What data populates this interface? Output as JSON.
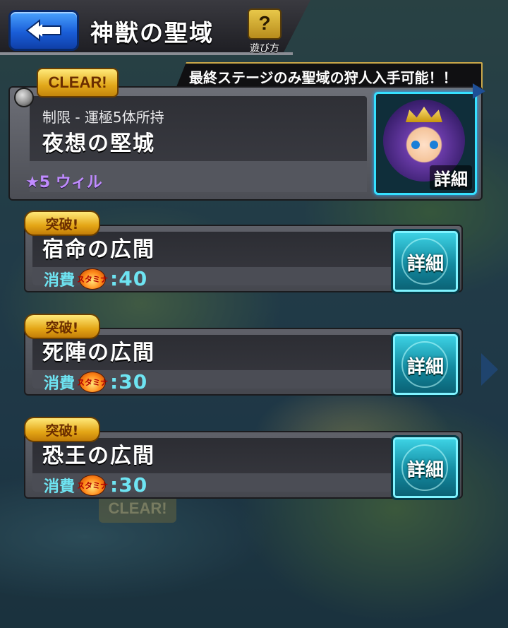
{
  "header": {
    "title": "神獣の聖域",
    "help_label": "遊び方",
    "help_glyph": "?"
  },
  "banner": {
    "text": "最終ステージのみ聖域の狩人入手可能！！"
  },
  "featured": {
    "clear_label": "CLEAR!",
    "restriction": "制限 - 運極5体所持",
    "stage_name": "夜想の堅城",
    "boss": "★5 ウィル",
    "detail_label": "詳細"
  },
  "background": {
    "clear_label": "CLEAR!"
  },
  "quests": [
    {
      "badge": "突破!",
      "name": "宿命の広間",
      "cost_label": "消費",
      "stamina_label": "スタミナ",
      "cost": ":40",
      "detail_label": "詳細"
    },
    {
      "badge": "突破!",
      "name": "死陣の広間",
      "cost_label": "消費",
      "stamina_label": "スタミナ",
      "cost": ":30",
      "detail_label": "詳細"
    },
    {
      "badge": "突破!",
      "name": "恐王の広間",
      "cost_label": "消費",
      "stamina_label": "スタミナ",
      "cost": ":30",
      "detail_label": "詳細"
    }
  ],
  "colors": {
    "accent_cyan": "#6ee4f2",
    "boss_purple": "#c08cff",
    "badge_gold": "#e4a616",
    "back_blue": "#1a5ed8"
  }
}
